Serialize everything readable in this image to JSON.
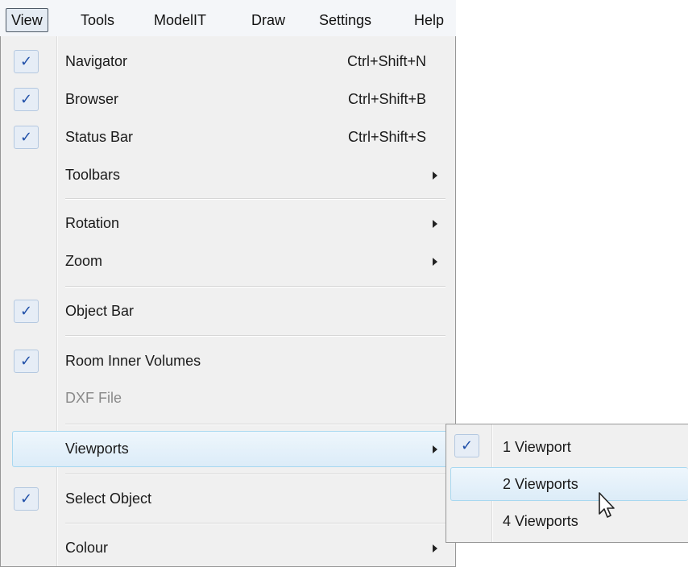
{
  "menubar": {
    "items": [
      "View",
      "Tools",
      "ModelIT",
      "Draw",
      "Settings",
      "Help"
    ]
  },
  "view_menu": {
    "items": [
      {
        "label": "Navigator",
        "shortcut": "Ctrl+Shift+N",
        "checked": true
      },
      {
        "label": "Browser",
        "shortcut": "Ctrl+Shift+B",
        "checked": true
      },
      {
        "label": "Status Bar",
        "shortcut": "Ctrl+Shift+S",
        "checked": true
      },
      {
        "label": "Toolbars",
        "submenu": true
      },
      {
        "label": "Rotation",
        "submenu": true
      },
      {
        "label": "Zoom",
        "submenu": true
      },
      {
        "label": "Object Bar",
        "checked": true
      },
      {
        "label": "Room Inner Volumes",
        "checked": true
      },
      {
        "label": "DXF File",
        "disabled": true
      },
      {
        "label": "Viewports",
        "submenu": true,
        "highlighted": true
      },
      {
        "label": "Select Object",
        "checked": true
      },
      {
        "label": "Colour",
        "submenu": true
      }
    ]
  },
  "viewports_submenu": {
    "items": [
      {
        "label": "1 Viewport",
        "checked": true
      },
      {
        "label": "2 Viewports",
        "highlighted": true
      },
      {
        "label": "4 Viewports"
      }
    ]
  },
  "icons": {
    "check": "✓",
    "submenu_arrow": "chevron-right-icon",
    "cursor": "mouse-pointer-icon"
  },
  "colors": {
    "check": "#1f4fa8",
    "highlight_border": "#a8d8f0",
    "menu_bg": "#f0f0f0"
  }
}
